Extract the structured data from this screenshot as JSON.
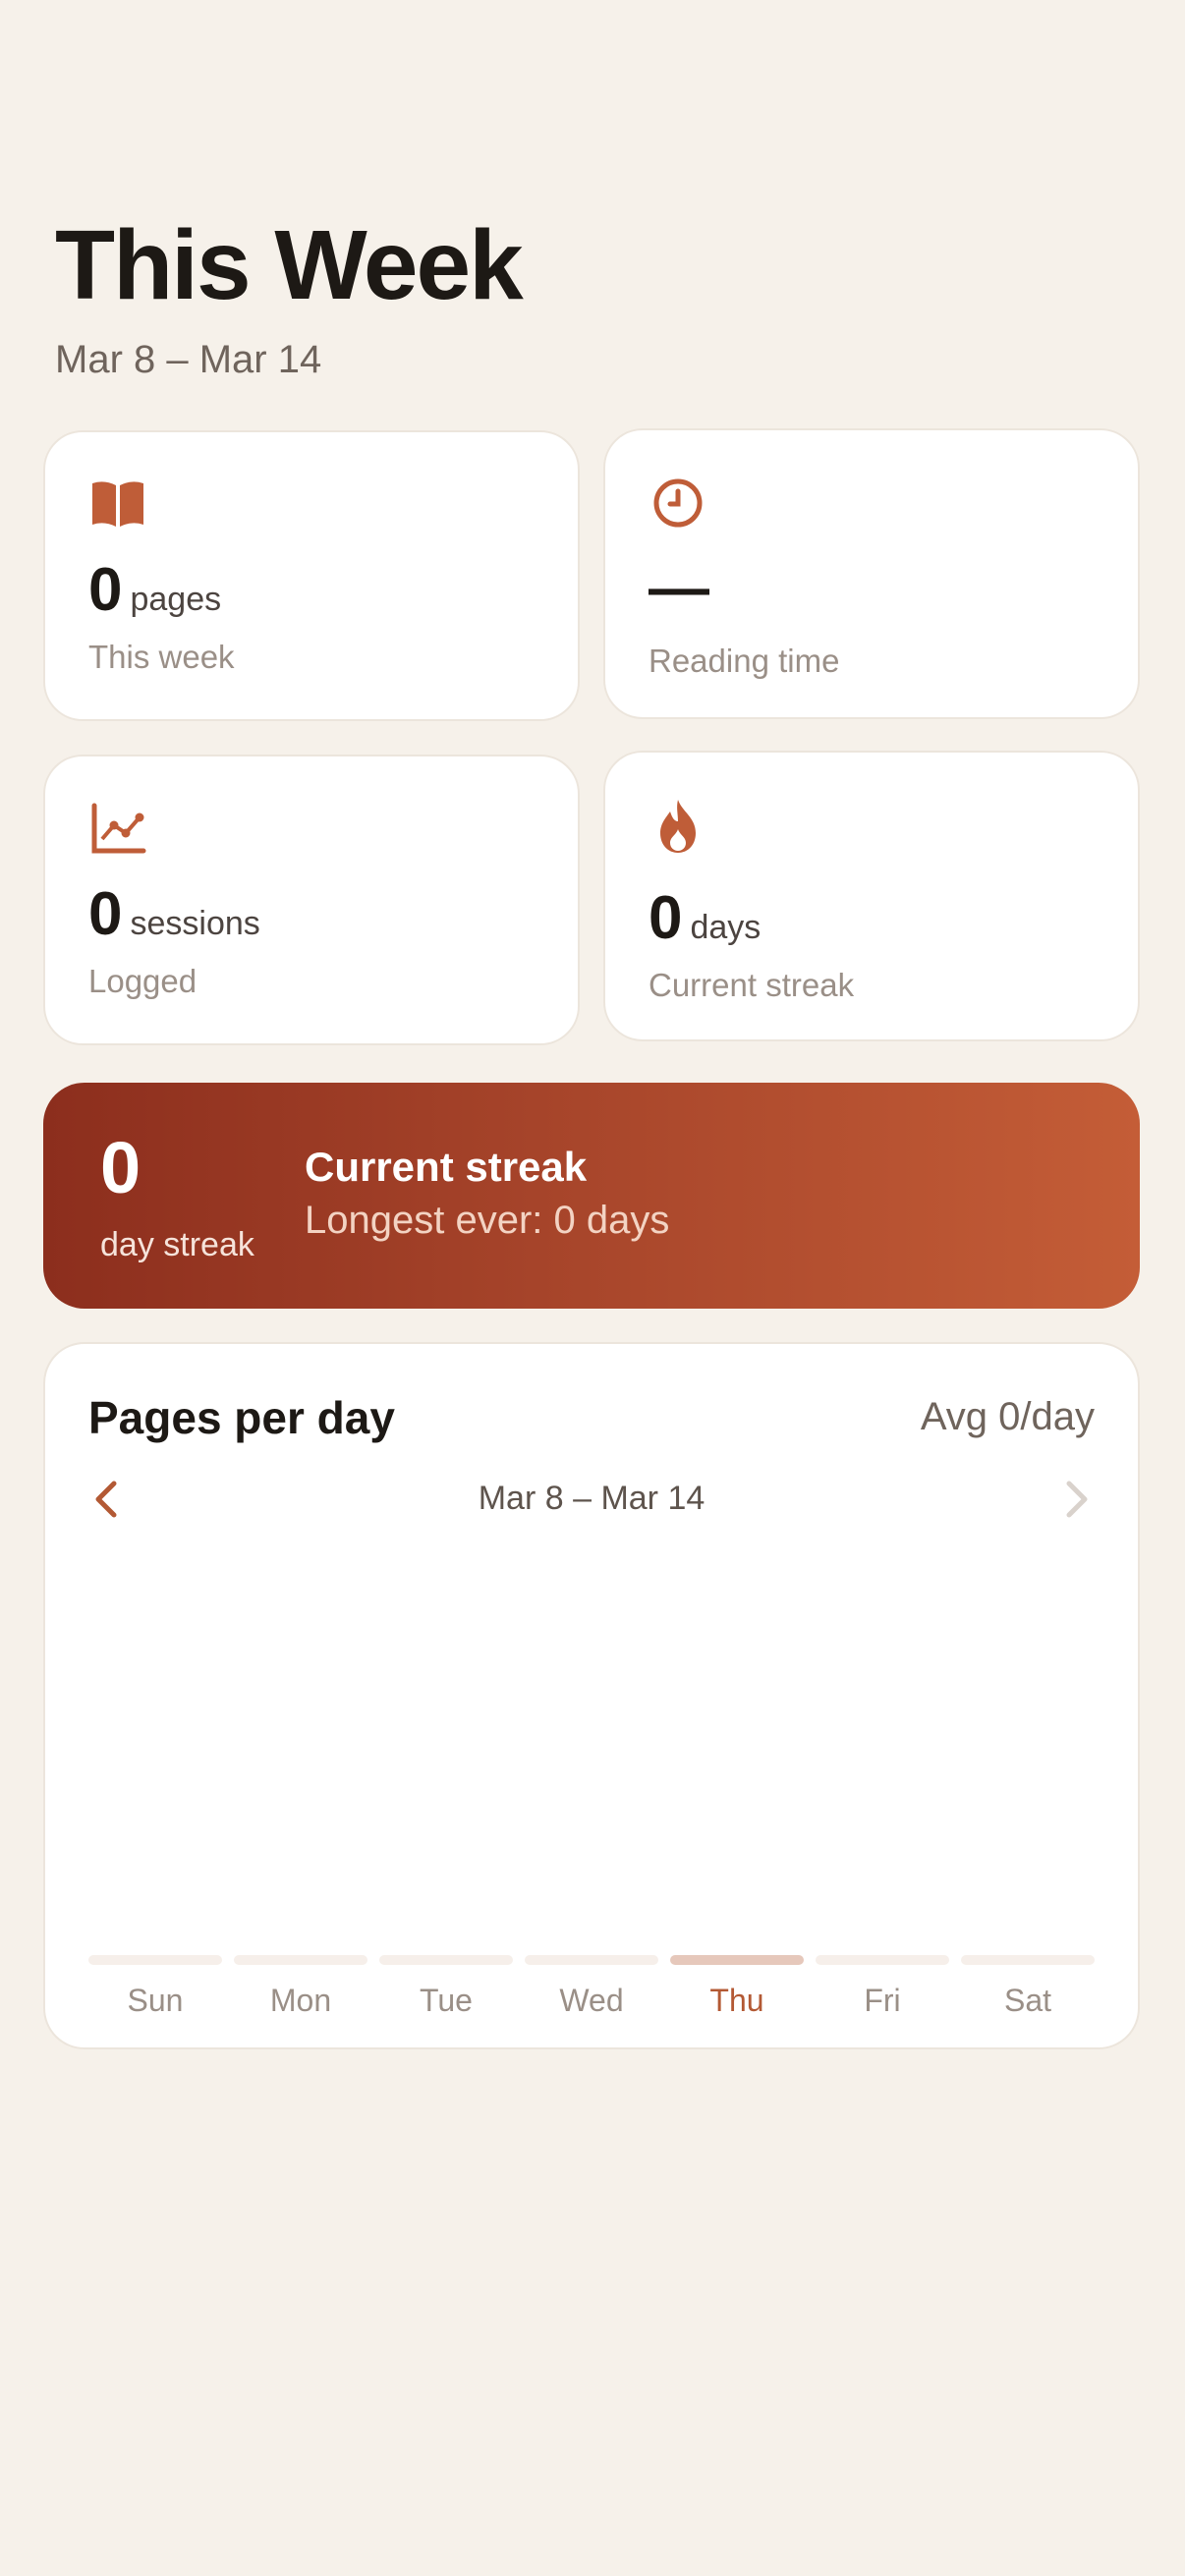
{
  "header": {
    "title": "This Week",
    "date_range": "Mar 8 – Mar 14"
  },
  "stats": [
    {
      "icon": "book-icon",
      "value": "0",
      "unit": "pages",
      "caption": "This week"
    },
    {
      "icon": "clock-icon",
      "value": "—",
      "unit": "",
      "caption": "Reading time"
    },
    {
      "icon": "chart-icon",
      "value": "0",
      "unit": "sessions",
      "caption": "Logged"
    },
    {
      "icon": "flame-icon",
      "value": "0",
      "unit": "days",
      "caption": "Current streak"
    }
  ],
  "streak_banner": {
    "value": "0",
    "value_label": "day streak",
    "heading": "Current streak",
    "longest": "Longest ever: 0 days"
  },
  "pages_chart": {
    "title": "Pages per day",
    "average": "Avg 0/day",
    "range": "Mar 8 – Mar 14",
    "days": [
      "Sun",
      "Mon",
      "Tue",
      "Wed",
      "Thu",
      "Fri",
      "Sat"
    ],
    "values": [
      0,
      0,
      0,
      0,
      0,
      0,
      0
    ],
    "highlighted_day": "Thu"
  },
  "colors": {
    "accent": "#b35934",
    "background": "#f6f1ea",
    "banner_start": "#8c2e1d",
    "banner_end": "#c45d37"
  }
}
